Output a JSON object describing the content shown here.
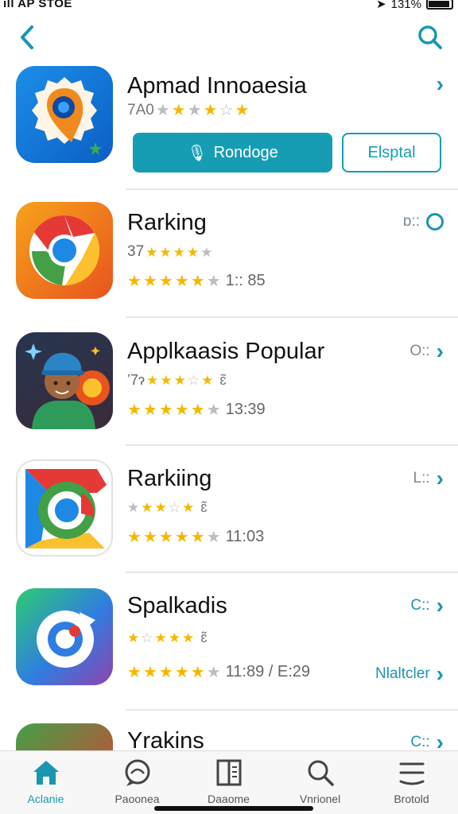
{
  "status_bar": {
    "carrier": "ıll AP STOE",
    "battery_text": "131%"
  },
  "featured": {
    "title": "Apmad Innoaesia",
    "rating_text": "7A0",
    "primary_button": "Rondoge",
    "secondary_button": "Elsptal"
  },
  "apps": [
    {
      "title": "Rarking",
      "sub_text": "37",
      "score_text": "1:: 85",
      "meta": "ɒ:: "
    },
    {
      "title": "Applkaasis Popular",
      "sub_text": "ʼ7ɂ",
      "sub_flag": "ɛ̃",
      "score_text": "13:39",
      "meta": "O:: "
    },
    {
      "title": "Rarkiing",
      "sub_text": "",
      "sub_flag": "ɛ̃",
      "score_text": "11:03",
      "meta": "L:: "
    },
    {
      "title": "Spalkadis",
      "sub_text": "",
      "sub_flag": "ɛ̃",
      "score_text": "11:89 / E:29",
      "meta": "C:: ",
      "extra_link": "Nlaltcler"
    },
    {
      "title": "Yrakins",
      "meta": "C:: "
    }
  ],
  "tabs": [
    {
      "label": "Aclanie",
      "icon": "home-icon"
    },
    {
      "label": "Paoonea",
      "icon": "chat-icon"
    },
    {
      "label": "Daaome",
      "icon": "book-icon"
    },
    {
      "label": "Vnrionel",
      "icon": "search-icon"
    },
    {
      "label": "Brotold",
      "icon": "menu-icon"
    }
  ],
  "colors": {
    "accent": "#169db3",
    "star": "#f5b800"
  }
}
